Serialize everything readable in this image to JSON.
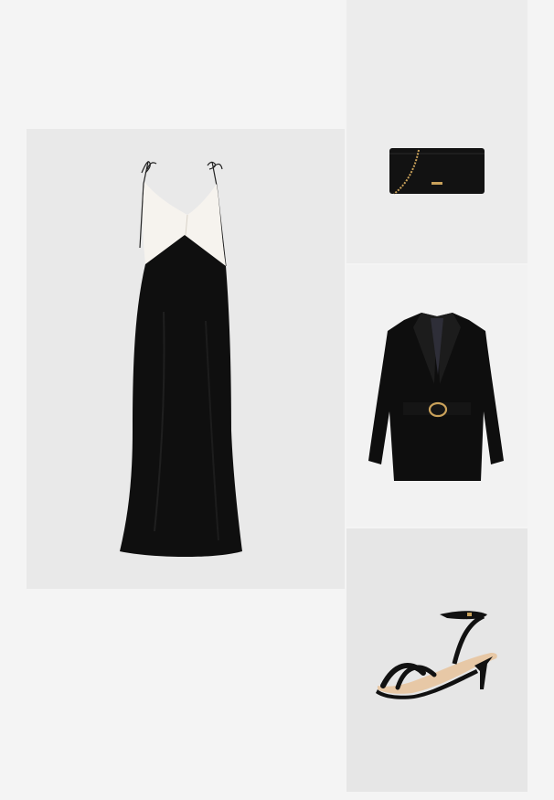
{
  "outfit": {
    "items": [
      {
        "id": "dress",
        "icon": "dress-icon"
      },
      {
        "id": "bag",
        "icon": "clutch-bag-icon"
      },
      {
        "id": "blazer",
        "icon": "blazer-icon"
      },
      {
        "id": "shoe",
        "icon": "sandal-icon"
      }
    ]
  },
  "colors": {
    "page_background": "#f4f4f4",
    "garment_black": "#0f0f0f",
    "dress_ivory": "#f6f3ee",
    "hardware_gold": "#c9a15a",
    "sandal_lining": "#e7c8a6"
  }
}
